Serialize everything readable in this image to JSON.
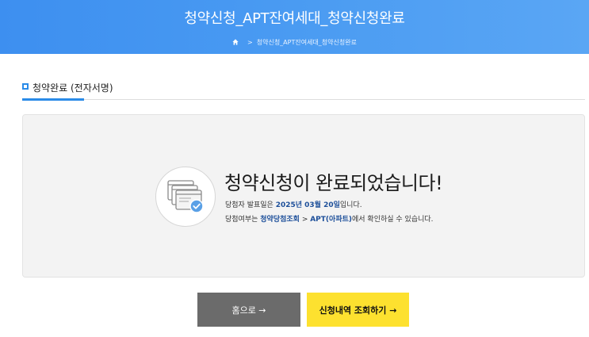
{
  "header": {
    "title": "청약신청_APT잔여세대_청약신청완료",
    "breadcrumb": {
      "separator": ">",
      "current": "청약신청_APT잔여세대_청약신청완료"
    }
  },
  "section": {
    "title": "청약완료 (전자서명)"
  },
  "message": {
    "title": "청약신청이 완료되었습니다!",
    "line1_prefix": "당첨자 발표일은 ",
    "line1_date": "2025년 03월 20일",
    "line1_suffix": "입니다.",
    "line2_prefix": "당첨여부는 ",
    "line2_link1": "청약당첨조회",
    "line2_arrow": " > ",
    "line2_link2": "APT(아파트)",
    "line2_suffix": "에서 확인하실 수 있습니다."
  },
  "buttons": {
    "home_label": "홈으로 →",
    "query_label": "신청내역 조회하기 →"
  },
  "colors": {
    "header": "#4a9bf2",
    "accent": "#2a8be8",
    "query_button": "#fde12f",
    "home_button": "#6b6b6b"
  },
  "icons": {
    "home": "home-icon",
    "success": "window-check-icon"
  }
}
